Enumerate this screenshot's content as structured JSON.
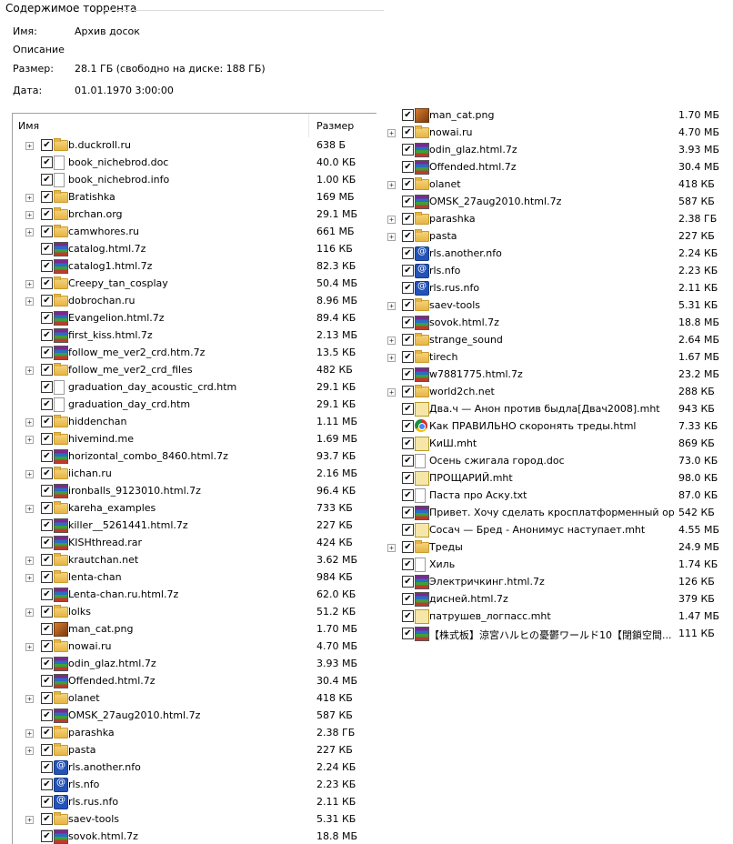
{
  "section": {
    "title": "Содержимое торрента"
  },
  "info": [
    {
      "label": "Имя:",
      "value": "Архив досок"
    },
    {
      "label": "Описание",
      "value": ""
    },
    {
      "label": "Размер:",
      "value": "28.1 ГБ (свободно на диске: 188 ГБ)"
    },
    {
      "label": "Дата:",
      "value": "01.01.1970 3:00:00"
    }
  ],
  "columns": {
    "name": "Имя",
    "size": "Размер"
  },
  "left_rows": [
    {
      "name": "b.duckroll.ru",
      "size": "638 Б",
      "type": "folder",
      "exp": true
    },
    {
      "name": "book_nichebrod.doc",
      "size": "40.0 КБ",
      "type": "doc",
      "exp": false
    },
    {
      "name": "book_nichebrod.info",
      "size": "1.00 КБ",
      "type": "doc",
      "exp": false
    },
    {
      "name": "Bratishka",
      "size": "169 МБ",
      "type": "folder",
      "exp": true
    },
    {
      "name": "brchan.org",
      "size": "29.1 МБ",
      "type": "folder",
      "exp": true
    },
    {
      "name": "camwhores.ru",
      "size": "661 МБ",
      "type": "folder",
      "exp": true
    },
    {
      "name": "catalog.html.7z",
      "size": "116 КБ",
      "type": "rar",
      "exp": false
    },
    {
      "name": "catalog1.html.7z",
      "size": "82.3 КБ",
      "type": "rar",
      "exp": false
    },
    {
      "name": "Creepy_tan_cosplay",
      "size": "50.4 МБ",
      "type": "folder",
      "exp": true
    },
    {
      "name": "dobrochan.ru",
      "size": "8.96 МБ",
      "type": "folder",
      "exp": true
    },
    {
      "name": "Evangelion.html.7z",
      "size": "89.4 КБ",
      "type": "rar",
      "exp": false
    },
    {
      "name": "first_kiss.html.7z",
      "size": "2.13 МБ",
      "type": "rar",
      "exp": false
    },
    {
      "name": "follow_me_ver2_crd.htm.7z",
      "size": "13.5 КБ",
      "type": "rar",
      "exp": false
    },
    {
      "name": "follow_me_ver2_crd_files",
      "size": "482 КБ",
      "type": "folder",
      "exp": true
    },
    {
      "name": "graduation_day_acoustic_crd.htm",
      "size": "29.1 КБ",
      "type": "doc",
      "exp": false
    },
    {
      "name": "graduation_day_crd.htm",
      "size": "29.1 КБ",
      "type": "doc",
      "exp": false
    },
    {
      "name": "hiddenchan",
      "size": "1.11 МБ",
      "type": "folder",
      "exp": true
    },
    {
      "name": "hivemind.me",
      "size": "1.69 МБ",
      "type": "folder",
      "exp": true
    },
    {
      "name": "horizontal_combo_8460.html.7z",
      "size": "93.7 КБ",
      "type": "rar",
      "exp": false
    },
    {
      "name": "iichan.ru",
      "size": "2.16 МБ",
      "type": "folder",
      "exp": true
    },
    {
      "name": "ironballs_9123010.html.7z",
      "size": "96.4 КБ",
      "type": "rar",
      "exp": false
    },
    {
      "name": "kareha_examples",
      "size": "733 КБ",
      "type": "folder",
      "exp": true
    },
    {
      "name": "killer__5261441.html.7z",
      "size": "227 КБ",
      "type": "rar",
      "exp": false
    },
    {
      "name": "KISHthread.rar",
      "size": "424 КБ",
      "type": "rar",
      "exp": false
    },
    {
      "name": "krautchan.net",
      "size": "3.62 МБ",
      "type": "folder",
      "exp": true
    },
    {
      "name": "lenta-chan",
      "size": "984 КБ",
      "type": "folder",
      "exp": true
    },
    {
      "name": "Lenta-chan.ru.html.7z",
      "size": "62.0 КБ",
      "type": "rar",
      "exp": false
    },
    {
      "name": "lolks",
      "size": "51.2 КБ",
      "type": "folder",
      "exp": true
    },
    {
      "name": "man_cat.png",
      "size": "1.70 МБ",
      "type": "img",
      "exp": false
    },
    {
      "name": "nowai.ru",
      "size": "4.70 МБ",
      "type": "folder",
      "exp": true
    },
    {
      "name": "odin_glaz.html.7z",
      "size": "3.93 МБ",
      "type": "rar",
      "exp": false
    },
    {
      "name": "Offended.html.7z",
      "size": "30.4 МБ",
      "type": "rar",
      "exp": false
    },
    {
      "name": "olanet",
      "size": "418 КБ",
      "type": "folder",
      "exp": true
    },
    {
      "name": "OMSK_27aug2010.html.7z",
      "size": "587 КБ",
      "type": "rar",
      "exp": false
    },
    {
      "name": "parashka",
      "size": "2.38 ГБ",
      "type": "folder",
      "exp": true
    },
    {
      "name": "pasta",
      "size": "227 КБ",
      "type": "folder",
      "exp": true
    },
    {
      "name": "rls.another.nfo",
      "size": "2.24 КБ",
      "type": "nfo",
      "exp": false
    },
    {
      "name": "rls.nfo",
      "size": "2.23 КБ",
      "type": "nfo",
      "exp": false
    },
    {
      "name": "rls.rus.nfo",
      "size": "2.11 КБ",
      "type": "nfo",
      "exp": false
    },
    {
      "name": "saev-tools",
      "size": "5.31 КБ",
      "type": "folder",
      "exp": true
    },
    {
      "name": "sovok.html.7z",
      "size": "18.8 МБ",
      "type": "rar",
      "exp": false
    }
  ],
  "right_rows": [
    {
      "name": "man_cat.png",
      "size": "1.70 МБ",
      "type": "img",
      "exp": false
    },
    {
      "name": "nowai.ru",
      "size": "4.70 МБ",
      "type": "folder",
      "exp": true
    },
    {
      "name": "odin_glaz.html.7z",
      "size": "3.93 МБ",
      "type": "rar",
      "exp": false
    },
    {
      "name": "Offended.html.7z",
      "size": "30.4 МБ",
      "type": "rar",
      "exp": false
    },
    {
      "name": "olanet",
      "size": "418 КБ",
      "type": "folder",
      "exp": true
    },
    {
      "name": "OMSK_27aug2010.html.7z",
      "size": "587 КБ",
      "type": "rar",
      "exp": false
    },
    {
      "name": "parashka",
      "size": "2.38 ГБ",
      "type": "folder",
      "exp": true
    },
    {
      "name": "pasta",
      "size": "227 КБ",
      "type": "folder",
      "exp": true
    },
    {
      "name": "rls.another.nfo",
      "size": "2.24 КБ",
      "type": "nfo",
      "exp": false
    },
    {
      "name": "rls.nfo",
      "size": "2.23 КБ",
      "type": "nfo",
      "exp": false
    },
    {
      "name": "rls.rus.nfo",
      "size": "2.11 КБ",
      "type": "nfo",
      "exp": false
    },
    {
      "name": "saev-tools",
      "size": "5.31 КБ",
      "type": "folder",
      "exp": true
    },
    {
      "name": "sovok.html.7z",
      "size": "18.8 МБ",
      "type": "rar",
      "exp": false
    },
    {
      "name": "strange_sound",
      "size": "2.64 МБ",
      "type": "folder",
      "exp": true
    },
    {
      "name": "tirech",
      "size": "1.67 МБ",
      "type": "folder",
      "exp": true
    },
    {
      "name": "w7881775.html.7z",
      "size": "23.2 МБ",
      "type": "rar",
      "exp": false
    },
    {
      "name": "world2ch.net",
      "size": "288 КБ",
      "type": "folder",
      "exp": true
    },
    {
      "name": "Два.ч — Анон против быдла[Двач2008].mht",
      "size": "943 КБ",
      "type": "mht",
      "exp": false
    },
    {
      "name": "Как ПРАВИЛЬНО скоронять треды.html",
      "size": "7.33 КБ",
      "type": "chrome",
      "exp": false
    },
    {
      "name": "КиШ.mht",
      "size": "869 КБ",
      "type": "mht",
      "exp": false
    },
    {
      "name": "Осень сжигала город.doc",
      "size": "73.0 КБ",
      "type": "doc",
      "exp": false
    },
    {
      "name": "ПРОЩАРИЙ.mht",
      "size": "98.0 КБ",
      "type": "mht",
      "exp": false
    },
    {
      "name": "Паста про Аску.txt",
      "size": "87.0 КБ",
      "type": "doc",
      "exp": false
    },
    {
      "name": "Привет. Хочу сделать кросплатформенный ор...",
      "size": "542 КБ",
      "type": "rar",
      "exp": false
    },
    {
      "name": "Сосач — Бред - Анонимус наступает.mht",
      "size": "4.55 МБ",
      "type": "mht",
      "exp": false
    },
    {
      "name": "Треды",
      "size": "24.9 МБ",
      "type": "folder",
      "exp": true
    },
    {
      "name": "Хиль",
      "size": "1.74 КБ",
      "type": "doc",
      "exp": false
    },
    {
      "name": "Электричкинг.html.7z",
      "size": "126 КБ",
      "type": "rar",
      "exp": false
    },
    {
      "name": "дисней.html.7z",
      "size": "379 КБ",
      "type": "rar",
      "exp": false
    },
    {
      "name": "патрушев_логпасс.mht",
      "size": "1.47 МБ",
      "type": "mht",
      "exp": false
    },
    {
      "name": "【株式板】涼宮ハルヒの憂鬱ワールド10【閉鎖空間...",
      "size": "111 КБ",
      "type": "rar",
      "exp": false
    }
  ],
  "icons": {
    "folder": "folder-icon",
    "doc": "document-icon",
    "rar": "archive-icon",
    "img": "image-icon",
    "nfo": "nfo-icon",
    "mht": "mht-icon",
    "chrome": "html-icon"
  }
}
